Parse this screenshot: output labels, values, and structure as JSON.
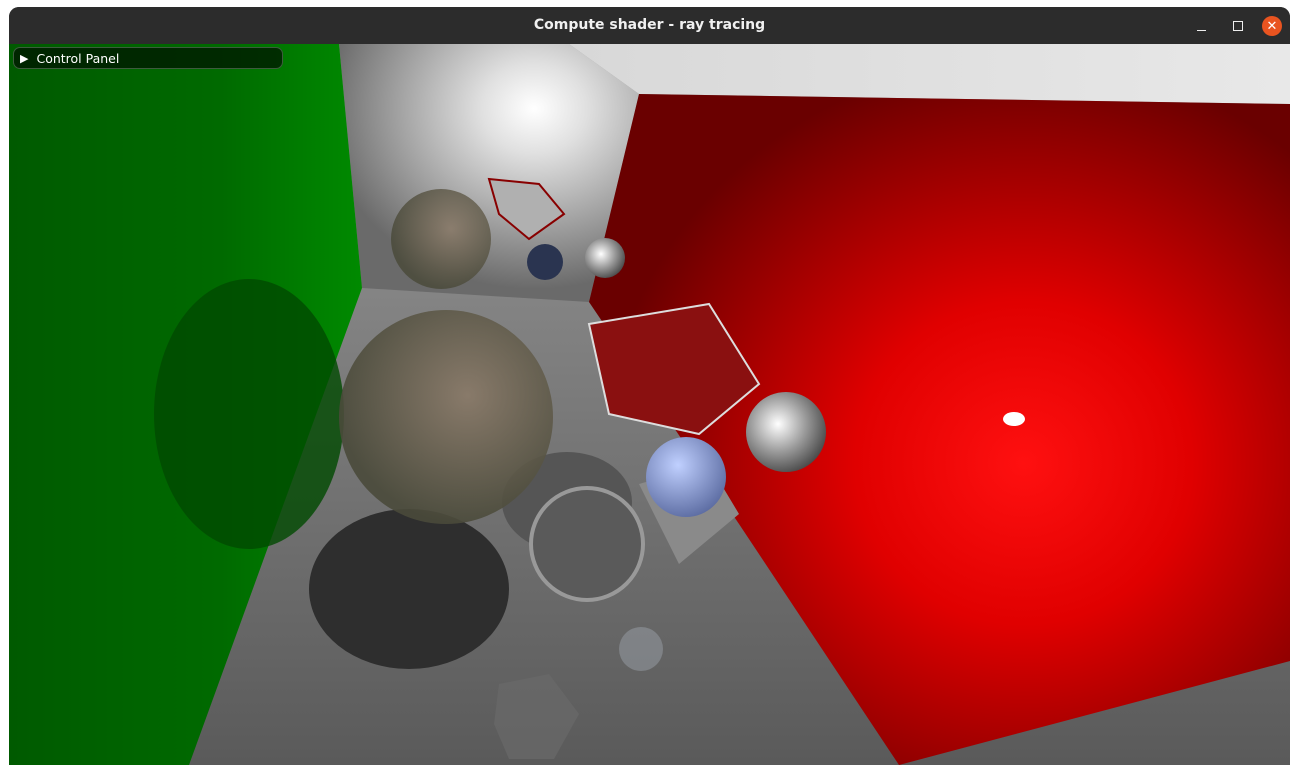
{
  "window": {
    "title": "Compute shader - ray tracing",
    "controls": {
      "minimize_icon": "minimize-icon",
      "maximize_icon": "maximize-icon",
      "close_icon": "close-icon",
      "close_color": "#e95420"
    }
  },
  "control_panel": {
    "label": "Control Panel",
    "expand_icon": "triangle-right-icon",
    "collapsed": true
  },
  "scene": {
    "colors": {
      "left_wall": "#007a00",
      "right_wall": "#e00000",
      "walls": "#9a9a9a",
      "floor": "#6e6e6e"
    }
  }
}
